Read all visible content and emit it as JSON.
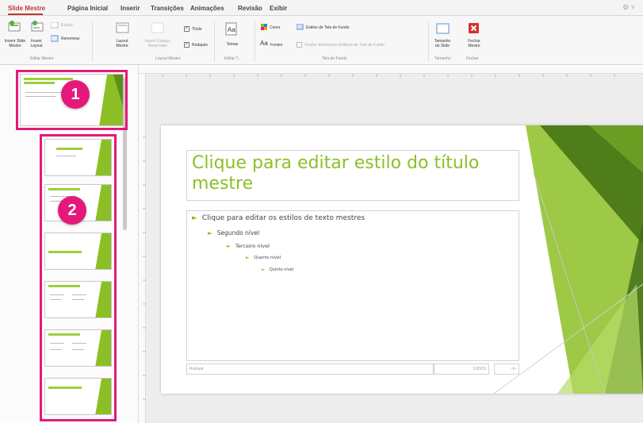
{
  "tabs": [
    "Slide Mestre",
    "Página Inicial",
    "Inserir",
    "Transições",
    "Animações",
    "Revisão",
    "Exibir"
  ],
  "ribbon": {
    "insert_slide_master": "Inserir Slide\nMestre",
    "insert_layout": "Inserir\nLayout",
    "delete": "Excluir",
    "rename": "Renomear",
    "group_edit_master": "Editar Mestre",
    "master_layout": "Layout\nMestre",
    "insert_placeholder": "Inserir Espaço\nReservado",
    "group_master_layout": "Layout Mestre",
    "title_check": "Título",
    "footers_check": "Rodapés",
    "themes": "Temas",
    "group_edit_theme": "Editar T...",
    "colors": "Cores",
    "fonts": "Fontes",
    "background_styles": "Estilos de Tela de Fundo",
    "hide_bg_graphics": "Ocultar Elementos Gráficos de Tela de Fundo",
    "group_background": "Tela de Fundo",
    "slide_size": "Tamanho\ndo Slide",
    "group_size": "Tamanho",
    "close_master": "Fechar\nMestre",
    "group_close": "Fechar"
  },
  "badges": [
    "1",
    "2"
  ],
  "slide": {
    "title": "Clique para editar estilo do título mestre",
    "levels": [
      "Clique para editar os estilos de texto mestres",
      "Segundo nível",
      "Terceiro nível",
      "Quarto nível",
      "Quinto nível"
    ],
    "footer": "Rodapé",
    "date": "1/20/15",
    "page": "‹#›"
  },
  "colors": {
    "accent_green": "#8cbf26",
    "highlight_pink": "#e4197b",
    "tab_red": "#c0392b"
  },
  "icons": [
    "insert-slide-master-icon",
    "insert-layout-icon",
    "delete-icon",
    "rename-icon",
    "master-layout-icon",
    "insert-placeholder-icon",
    "themes-icon",
    "colors-icon",
    "fonts-icon",
    "background-styles-icon",
    "slide-size-icon",
    "close-master-icon",
    "settings-icon"
  ]
}
